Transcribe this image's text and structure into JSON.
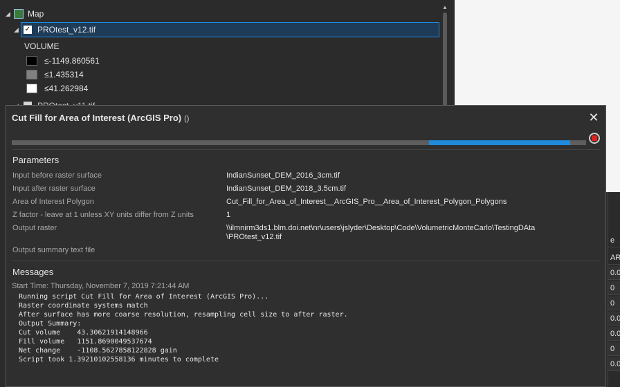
{
  "toc": {
    "map_label": "Map",
    "layer_name": "PROtest_v12.tif",
    "symbology_heading": "VOLUME",
    "legend": [
      {
        "label": "≤-1149.860561",
        "color": "#000000"
      },
      {
        "label": "≤1.435314",
        "color": "#808080"
      },
      {
        "label": "≤41.262984",
        "color": "#ffffff"
      }
    ],
    "next_layer_partial": "PROtest_v11.tif"
  },
  "side_table": {
    "header_partial": "e",
    "col_label": "AR",
    "values": [
      "0.0",
      "0",
      "0",
      "0.0",
      "0.0",
      "0",
      "0.0"
    ]
  },
  "dialog": {
    "title": "Cut Fill for Area of Interest (ArcGIS Pro)",
    "title_suffix": "()",
    "progress": {
      "start": 0.726,
      "end": 0.972
    },
    "parameters_heading": "Parameters",
    "parameters": [
      {
        "label": "Input before raster surface",
        "value": "IndianSunset_DEM_2016_3cm.tif"
      },
      {
        "label": "Input after raster surface",
        "value": "IndianSunset_DEM_2018_3.5cm.tif"
      },
      {
        "label": "Area of Interest Polygon",
        "value": "Cut_Fill_for_Area_of_Interest__ArcGIS_Pro__Area_of_Interest_Polygon_Polygons"
      },
      {
        "label": "Z factor - leave at 1 unless XY units differ from Z units",
        "value": "1"
      },
      {
        "label": "Output raster",
        "value": "\\\\ilmnirm3ds1.blm.doi.net\\nr\\users\\jslyder\\Desktop\\Code\\VolumetricMonteCarlo\\TestingDAta",
        "value2": "\\PROtest_v12.tif"
      },
      {
        "label": "Output summary text file",
        "value": ""
      }
    ],
    "messages_heading": "Messages",
    "start_time": "Start Time: Thursday, November 7, 2019 7:21:44 AM",
    "messages_text": "Running script Cut Fill for Area of Interest (ArcGIS Pro)...\nRaster coordinate systems match\nAfter surface has more coarse resolution, resampling cell size to after raster.\nOutput Summary:\nCut volume    43.30621914148966\nFill volume   1151.8690049537674\nNet change    -1108.5627858122828 gain\nScript took 1.39210102558136 minutes to complete"
  }
}
